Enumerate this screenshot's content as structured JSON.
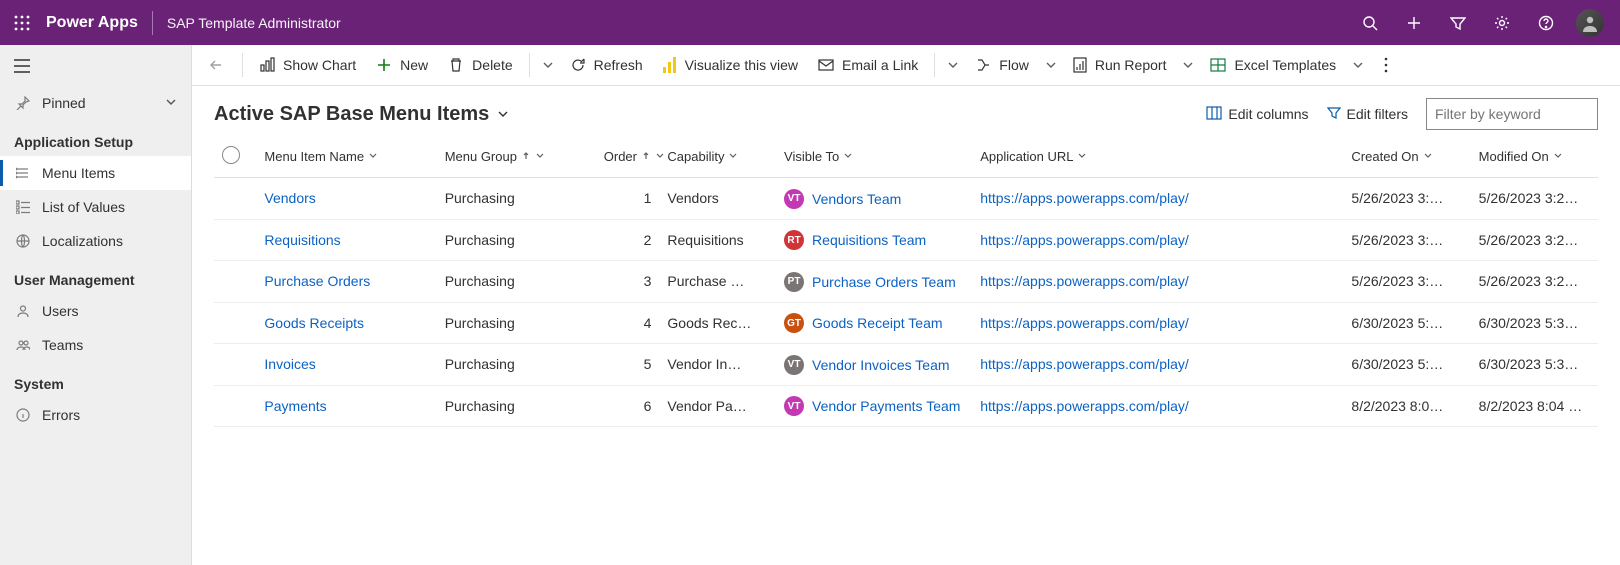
{
  "header": {
    "product": "Power Apps",
    "app_name": "SAP Template Administrator"
  },
  "sidebar": {
    "pinned_label": "Pinned",
    "sections": [
      {
        "title": "Application Setup",
        "items": [
          {
            "label": "Menu Items",
            "selected": true
          },
          {
            "label": "List of Values",
            "selected": false
          },
          {
            "label": "Localizations",
            "selected": false
          }
        ]
      },
      {
        "title": "User Management",
        "items": [
          {
            "label": "Users",
            "selected": false
          },
          {
            "label": "Teams",
            "selected": false
          }
        ]
      },
      {
        "title": "System",
        "items": [
          {
            "label": "Errors",
            "selected": false
          }
        ]
      }
    ]
  },
  "commands": {
    "show_chart": "Show Chart",
    "new": "New",
    "delete": "Delete",
    "refresh": "Refresh",
    "visualize": "Visualize this view",
    "email_link": "Email a Link",
    "flow": "Flow",
    "run_report": "Run Report",
    "excel_templates": "Excel Templates"
  },
  "view": {
    "title": "Active SAP Base Menu Items",
    "edit_columns": "Edit columns",
    "edit_filters": "Edit filters",
    "filter_placeholder": "Filter by keyword"
  },
  "columns": {
    "name": "Menu Item Name",
    "group": "Menu Group",
    "order": "Order",
    "capability": "Capability",
    "visible_to": "Visible To",
    "url": "Application URL",
    "created": "Created On",
    "modified": "Modified On"
  },
  "rows": [
    {
      "name": "Vendors",
      "group": "Purchasing",
      "order": "1",
      "capability": "Vendors",
      "team_initials": "VT",
      "team_color": "#c239b3",
      "team_name": "Vendors Team",
      "url": "https://apps.powerapps.com/play/",
      "created": "5/26/2023 3:…",
      "modified": "5/26/2023 3:2…"
    },
    {
      "name": "Requisitions",
      "group": "Purchasing",
      "order": "2",
      "capability": "Requisitions",
      "team_initials": "RT",
      "team_color": "#d13438",
      "team_name": "Requisitions Team",
      "url": "https://apps.powerapps.com/play/",
      "created": "5/26/2023 3:…",
      "modified": "5/26/2023 3:2…"
    },
    {
      "name": "Purchase Orders",
      "group": "Purchasing",
      "order": "3",
      "capability": "Purchase …",
      "team_initials": "PT",
      "team_color": "#7a7574",
      "team_name": "Purchase Orders Team",
      "url": "https://apps.powerapps.com/play/",
      "created": "5/26/2023 3:…",
      "modified": "5/26/2023 3:2…"
    },
    {
      "name": "Goods Receipts",
      "group": "Purchasing",
      "order": "4",
      "capability": "Goods Rec…",
      "team_initials": "GT",
      "team_color": "#ca5010",
      "team_name": "Goods Receipt Team",
      "url": "https://apps.powerapps.com/play/",
      "created": "6/30/2023 5:…",
      "modified": "6/30/2023 5:3…"
    },
    {
      "name": "Invoices",
      "group": "Purchasing",
      "order": "5",
      "capability": "Vendor In…",
      "team_initials": "VT",
      "team_color": "#7a7574",
      "team_name": "Vendor Invoices Team",
      "url": "https://apps.powerapps.com/play/",
      "created": "6/30/2023 5:…",
      "modified": "6/30/2023 5:3…"
    },
    {
      "name": "Payments",
      "group": "Purchasing",
      "order": "6",
      "capability": "Vendor Pa…",
      "team_initials": "VT",
      "team_color": "#c239b3",
      "team_name": "Vendor Payments Team",
      "url": "https://apps.powerapps.com/play/",
      "created": "8/2/2023 8:0…",
      "modified": "8/2/2023 8:04 …"
    }
  ]
}
